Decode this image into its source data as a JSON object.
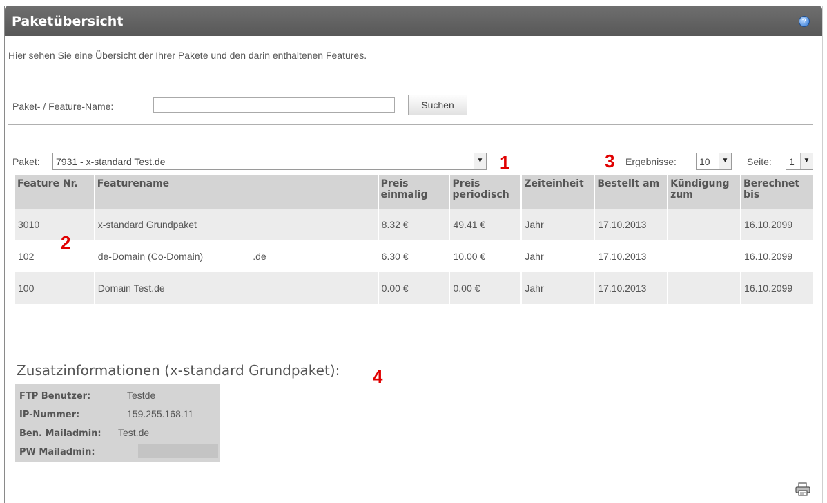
{
  "header": {
    "title": "Paketübersicht",
    "help_icon": "help-icon"
  },
  "intro": "Hier sehen Sie eine Übersicht der Ihrer Pakete und den darin enthaltenen Features.",
  "search": {
    "label": "Paket- / Feature-Name:",
    "value": "",
    "placeholder": "",
    "button_label": "Suchen"
  },
  "paket": {
    "label": "Paket:",
    "selected": "7931 - x-standard Test.de"
  },
  "results": {
    "label": "Ergebnisse:",
    "selected": "10"
  },
  "page": {
    "label": "Seite:",
    "selected": "1"
  },
  "markers": {
    "m1": "1",
    "m2": "2",
    "m3": "3",
    "m4": "4"
  },
  "table": {
    "headers": {
      "feature_nr": "Feature Nr.",
      "featurename": "Featurename",
      "preis_einmalig": "Preis einmalig",
      "preis_periodisch": "Preis periodisch",
      "zeiteinheit": "Zeiteinheit",
      "bestellt_am": "Bestellt am",
      "kuendigung_zum": "Kündigung zum",
      "berechnet_bis": "Berechnet bis"
    },
    "rows": [
      {
        "nr": "3010",
        "name": "x-standard Grundpaket",
        "einmalig": "8.32 €",
        "periodisch": "49.41 €",
        "zeiteinheit": "Jahr",
        "bestellt": "17.10.2013",
        "kuendigung": "",
        "berechnet": "16.10.2099"
      },
      {
        "nr": "102",
        "name": "de-Domain (Co-Domain)",
        "name_suffix": ".de",
        "einmalig": "6.30 €",
        "periodisch": "10.00 €",
        "zeiteinheit": "Jahr",
        "bestellt": "17.10.2013",
        "kuendigung": "",
        "berechnet": "16.10.2099"
      },
      {
        "nr": "100",
        "name": "Domain Test.de",
        "einmalig": "0.00 €",
        "periodisch": "0.00 €",
        "zeiteinheit": "Jahr",
        "bestellt": "17.10.2013",
        "kuendigung": "",
        "berechnet": "16.10.2099"
      }
    ]
  },
  "zusatz": {
    "title": "Zusatzinformationen (x-standard Grundpaket):",
    "ftp_label": "FTP Benutzer:",
    "ftp_value": "Testde",
    "ip_label": "IP-Nummer:",
    "ip_value": "159.255.168.11",
    "mailadmin_label": "Ben. Mailadmin:",
    "mailadmin_value": "Test.de",
    "pw_label": "PW Mailadmin:"
  },
  "icons": {
    "print": "printer-icon",
    "dropdown": "chevron-down-icon"
  }
}
